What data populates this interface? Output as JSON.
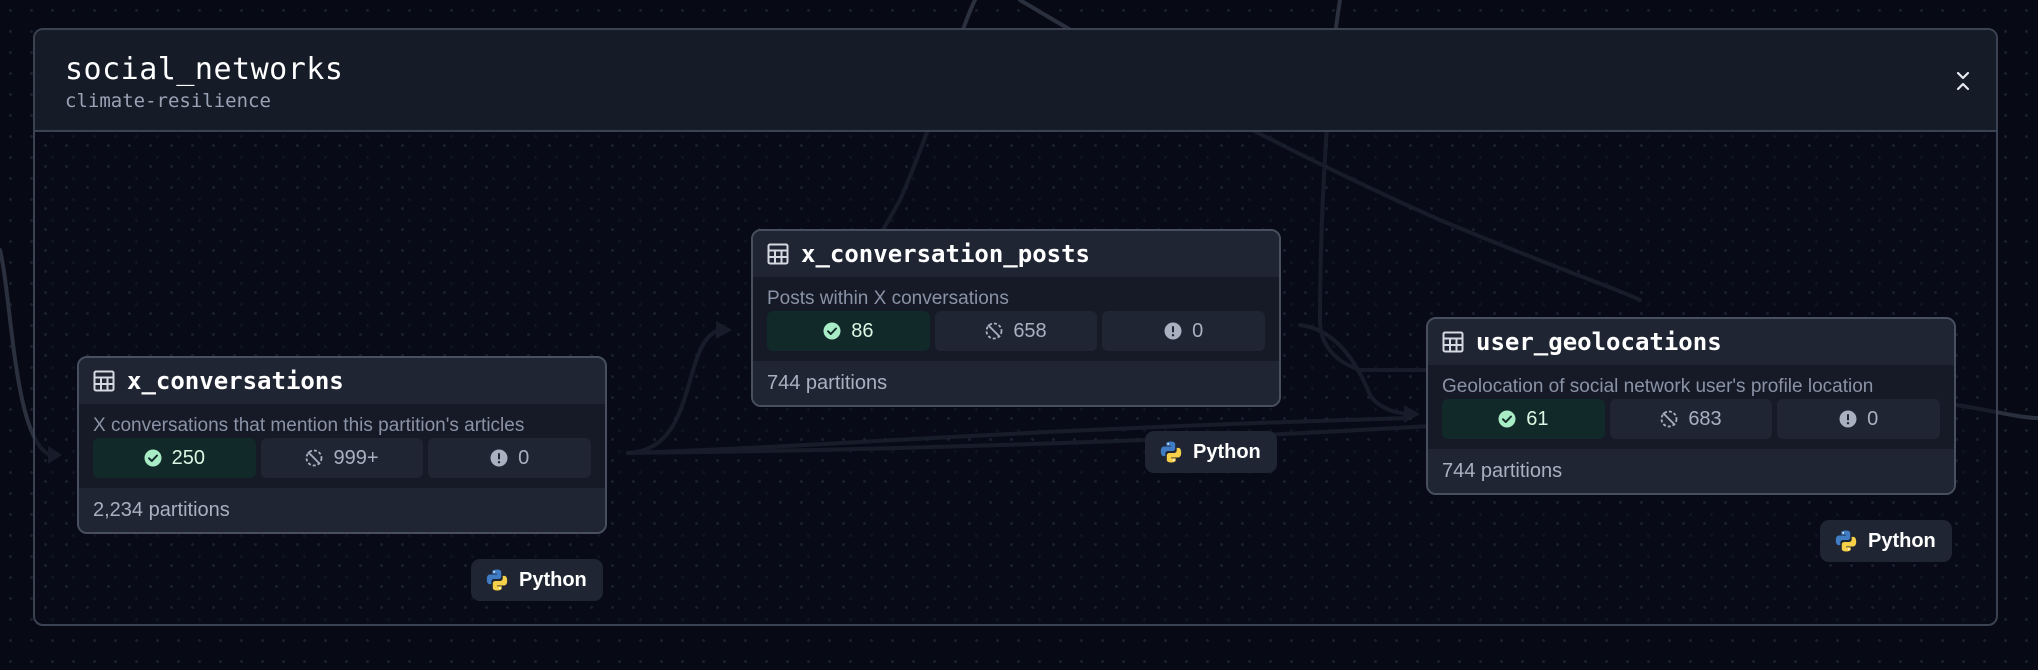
{
  "group": {
    "title": "social_networks",
    "subtitle": "climate-resilience",
    "collapse_icon": "chevrons-collapse-icon"
  },
  "nodes": [
    {
      "title": "x_conversations",
      "description": "X conversations that mention this partition's articles",
      "stats": {
        "materialized": "250",
        "missing": "999+",
        "failed": "0"
      },
      "partitions": "2,234 partitions",
      "kind": "Python"
    },
    {
      "title": "x_conversation_posts",
      "description": "Posts within X conversations",
      "stats": {
        "materialized": "86",
        "missing": "658",
        "failed": "0"
      },
      "partitions": "744 partitions",
      "kind": "Python"
    },
    {
      "title": "user_geolocations",
      "description": "Geolocation of social network user's profile location",
      "stats": {
        "materialized": "61",
        "missing": "683",
        "failed": "0"
      },
      "partitions": "744 partitions",
      "kind": "Python"
    }
  ],
  "icons": {
    "table": "table-icon",
    "materialized": "check-circle-icon",
    "missing": "missing-icon",
    "failed": "alert-circle-icon",
    "kind": "python-icon"
  },
  "colors": {
    "background": "#070a14",
    "node_border": "#48505f",
    "success_bg": "#12292a",
    "success_icon": "#a7ecc4",
    "edge": "#2c3140"
  }
}
